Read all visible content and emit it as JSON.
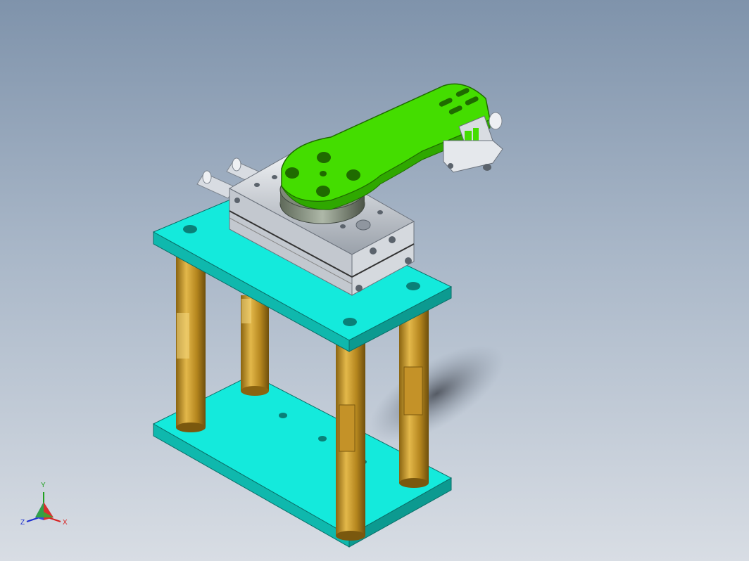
{
  "viewport": {
    "background_top": "#7f93ab",
    "background_bottom": "#d8dde4"
  },
  "model": {
    "plate_color": "#14eadc",
    "plate_edge_color": "#0a8f86",
    "pillar_color": "#c89a2a",
    "cylinder_color": "#c8cdd4",
    "arm_color": "#44dd00",
    "arm_edge_color": "#1f6b00"
  },
  "triad": {
    "x_label": "X",
    "y_label": "Y",
    "z_label": "Z",
    "x_color": "#d82020",
    "y_color": "#20a020",
    "z_color": "#2030d0"
  }
}
